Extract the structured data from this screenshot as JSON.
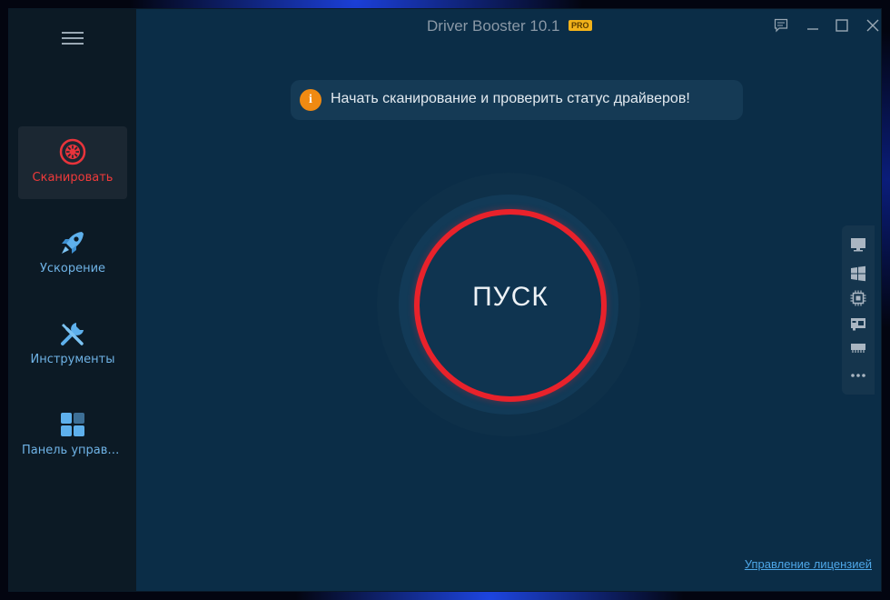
{
  "app": {
    "title": "Driver Booster 10",
    "version_minor": ".1",
    "badge": "PRO"
  },
  "sidebar": {
    "items": [
      {
        "label": "Сканировать",
        "icon": "scan-icon",
        "active": true
      },
      {
        "label": "Ускорение",
        "icon": "rocket-icon",
        "active": false
      },
      {
        "label": "Инструменты",
        "icon": "tools-icon",
        "active": false
      },
      {
        "label": "Панель управлен...",
        "icon": "dashboard-icon",
        "active": false
      }
    ]
  },
  "tip": {
    "icon": "info-icon",
    "text": "Начать сканирование и проверить статус драйверов!"
  },
  "start": {
    "label": "ПУСК"
  },
  "rightbar": {
    "icons": [
      "monitor-icon",
      "windows-icon",
      "cpu-icon",
      "network-card-icon",
      "memory-icon",
      "more-icon"
    ]
  },
  "footer": {
    "license_link": "Управление лицензией"
  },
  "colors": {
    "accent_red": "#e8222b",
    "link_blue": "#4ea7e8",
    "info_orange": "#f08a12",
    "badge_yellow": "#f2b21a"
  }
}
